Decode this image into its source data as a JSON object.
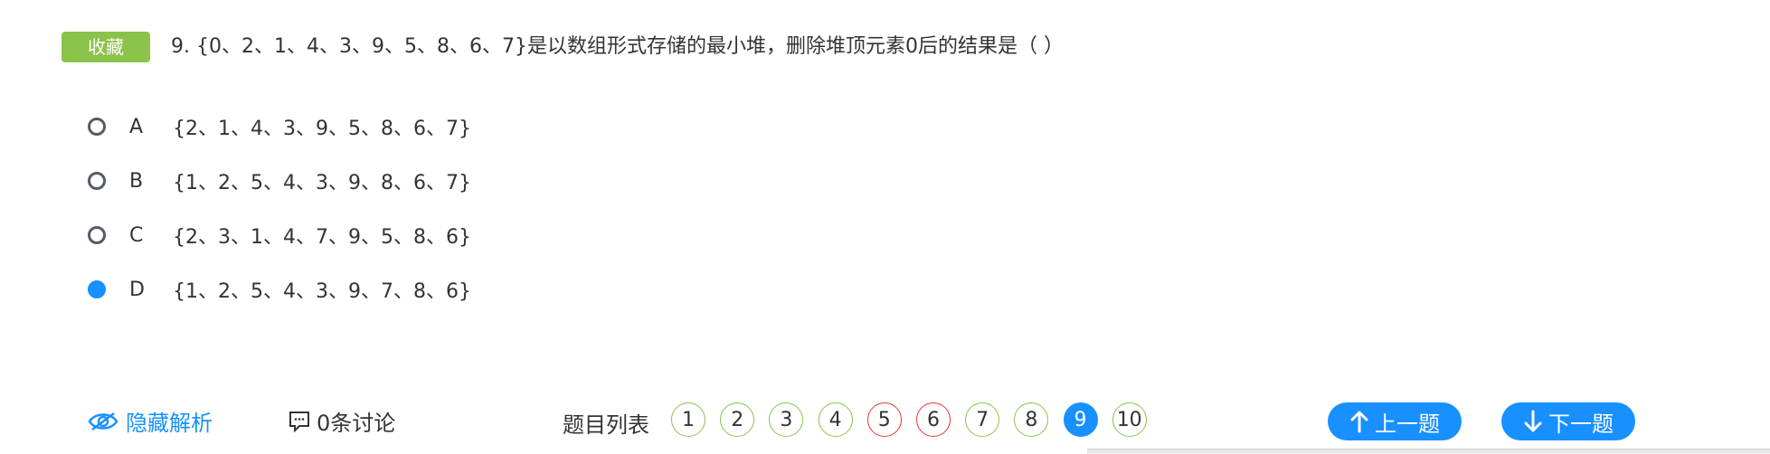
{
  "favorite_label": "收藏",
  "question": {
    "text": "9. {0、2、1、4、3、9、5、8、6、7}是以数组形式存储的最小堆，删除堆顶元素0后的结果是（ ）"
  },
  "options": [
    {
      "letter": "A",
      "text": "{2、1、4、3、9、5、8、6、7}",
      "selected": false
    },
    {
      "letter": "B",
      "text": "{1、2、5、4、3、9、8、6、7}",
      "selected": false
    },
    {
      "letter": "C",
      "text": "{2、3、1、4、7、9、5、8、6}",
      "selected": false
    },
    {
      "letter": "D",
      "text": "{1、2、5、4、3、9、7、8、6}",
      "selected": true
    }
  ],
  "toolbar": {
    "hide_analysis_label": "隐藏解析",
    "discussion_label": "0条讨论",
    "question_list_label": "题目列表",
    "question_numbers": [
      {
        "num": "1",
        "status": "correct"
      },
      {
        "num": "2",
        "status": "correct"
      },
      {
        "num": "3",
        "status": "correct"
      },
      {
        "num": "4",
        "status": "correct"
      },
      {
        "num": "5",
        "status": "wrong"
      },
      {
        "num": "6",
        "status": "wrong"
      },
      {
        "num": "7",
        "status": "correct"
      },
      {
        "num": "8",
        "status": "correct"
      },
      {
        "num": "9",
        "status": "current"
      },
      {
        "num": "10",
        "status": "correct"
      }
    ],
    "prev_label": "上一题",
    "next_label": "下一题"
  },
  "colors": {
    "accent": "#1890ff",
    "favorite_bg": "#8bc34a",
    "correct_border": "#8bc34a",
    "wrong_border": "#e53935"
  },
  "icons": {
    "analysis": "eye-icon",
    "discussion": "chat-bubble-icon",
    "prev": "arrow-up-icon",
    "next": "arrow-down-icon"
  }
}
